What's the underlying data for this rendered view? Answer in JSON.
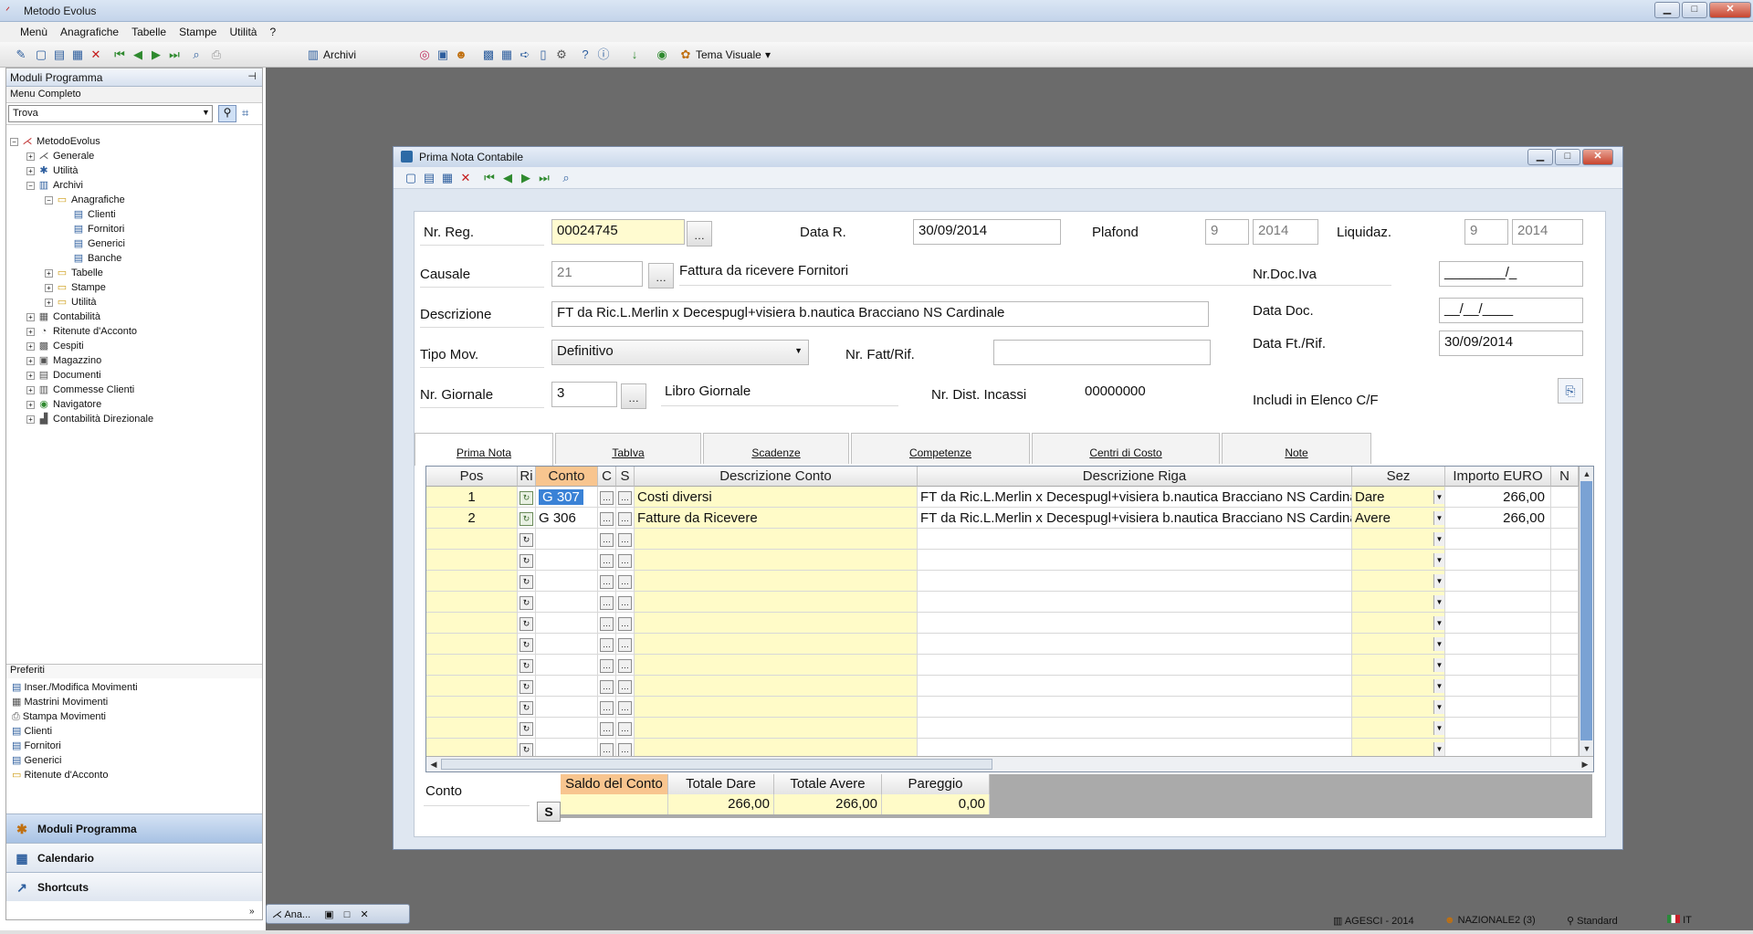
{
  "app": {
    "title": "Metodo Evolus"
  },
  "menu": [
    "Menù",
    "Anagrafiche",
    "Tabelle",
    "Stampe",
    "Utilità",
    "?"
  ],
  "toolbar": {
    "archivi_label": "Archivi",
    "theme_label": "Tema Visuale"
  },
  "left": {
    "header": "Moduli Programma",
    "subheader": "Menu Completo",
    "find_value": "Trova",
    "tree": [
      {
        "label": "MetodoEvolus",
        "level": 0,
        "icon": "root-icon"
      },
      {
        "label": "Generale",
        "level": 1,
        "icon": "module-icon"
      },
      {
        "label": "Utilità",
        "level": 1,
        "icon": "module-icon"
      },
      {
        "label": "Archivi",
        "level": 1,
        "icon": "module-icon"
      },
      {
        "label": "Anagrafiche",
        "level": 2,
        "icon": "folder-icon"
      },
      {
        "label": "Clienti",
        "level": 3,
        "icon": "form-icon"
      },
      {
        "label": "Fornitori",
        "level": 3,
        "icon": "form-icon"
      },
      {
        "label": "Generici",
        "level": 3,
        "icon": "form-icon"
      },
      {
        "label": "Banche",
        "level": 3,
        "icon": "form-icon"
      },
      {
        "label": "Tabelle",
        "level": 2,
        "icon": "folder-icon"
      },
      {
        "label": "Stampe",
        "level": 2,
        "icon": "folder-icon"
      },
      {
        "label": "Utilità",
        "level": 2,
        "icon": "folder-icon"
      },
      {
        "label": "Contabilità",
        "level": 1,
        "icon": "module-icon"
      },
      {
        "label": "Ritenute d'Acconto",
        "level": 1,
        "icon": "module-icon"
      },
      {
        "label": "Cespiti",
        "level": 1,
        "icon": "module-icon"
      },
      {
        "label": "Magazzino",
        "level": 1,
        "icon": "module-icon"
      },
      {
        "label": "Documenti",
        "level": 1,
        "icon": "module-icon"
      },
      {
        "label": "Commesse Clienti",
        "level": 1,
        "icon": "module-icon"
      },
      {
        "label": "Navigatore",
        "level": 1,
        "icon": "module-icon"
      },
      {
        "label": "Contabilità Direzionale",
        "level": 1,
        "icon": "module-icon"
      }
    ],
    "favorites_header": "Preferiti",
    "favorites": [
      "Inser./Modifica Movimenti",
      "Mastrini Movimenti",
      "Stampa Movimenti",
      "Clienti",
      "Fornitori",
      "Generici",
      "Ritenute d'Acconto"
    ],
    "nav": [
      "Moduli Programma",
      "Calendario",
      "Shortcuts"
    ]
  },
  "taskbar": {
    "mini_label": "Ana..."
  },
  "status": {
    "db": "AGESCI - 2014",
    "user": "NAZIONALE2 (3)",
    "profile": "Standard",
    "lang": "IT"
  },
  "dialog": {
    "title": "Prima Nota Contabile",
    "fields": {
      "nr_reg_label": "Nr. Reg.",
      "nr_reg": "00024745",
      "data_r_label": "Data R.",
      "data_r": "30/09/2014",
      "plafond_label": "Plafond",
      "plafond_month": "9",
      "plafond_year": "2014",
      "liquidaz_label": "Liquidaz.",
      "liquidaz_month": "9",
      "liquidaz_year": "2014",
      "causale_label": "Causale",
      "causale_code": "21",
      "causale_desc": "Fattura da ricevere Fornitori",
      "nr_doc_iva_label": "Nr.Doc.Iva",
      "nr_doc_iva": "________/_",
      "descrizione_label": "Descrizione",
      "descrizione": "FT da Ric.L.Merlin x Decespugl+visiera b.nautica Bracciano NS Cardinale",
      "data_doc_label": "Data Doc.",
      "data_doc": "__/__/____",
      "tipo_mov_label": "Tipo Mov.",
      "tipo_mov": "Definitivo",
      "nr_fatt_label": "Nr. Fatt/Rif.",
      "nr_fatt": "",
      "data_ft_label": "Data Ft./Rif.",
      "data_ft": "30/09/2014",
      "nr_giornale_label": "Nr. Giornale",
      "nr_giornale": "3",
      "libro_giornale_label": "Libro Giornale",
      "nr_dist_label": "Nr. Dist. Incassi",
      "nr_dist": "00000000",
      "includi_label": "Includi in Elenco C/F"
    },
    "tabs": [
      "Prima Nota",
      "TabIva",
      "Scadenze",
      "Competenze",
      "Centri di Costo",
      "Note"
    ],
    "grid": {
      "headers": [
        "Pos",
        "Ri",
        "Conto",
        "C",
        "S",
        "Descrizione Conto",
        "Descrizione Riga",
        "Sez",
        "Importo EURO",
        "N"
      ],
      "rows": [
        {
          "pos": "1",
          "conto": "G  307",
          "desc_conto": "Costi diversi",
          "desc_riga": "FT da Ric.L.Merlin x Decespugl+visiera b.nautica Bracciano NS Cardinale",
          "sez": "Dare",
          "importo": "266,00"
        },
        {
          "pos": "2",
          "conto": "G  306",
          "desc_conto": "Fatture da Ricevere",
          "desc_riga": "FT da Ric.L.Merlin x Decespugl+visiera b.nautica Bracciano NS Cardinale",
          "sez": "Avere",
          "importo": "266,00"
        }
      ],
      "empty_rows": 11
    },
    "totals": {
      "conto_label": "Conto",
      "s_button": "S",
      "headers": [
        "Saldo del Conto",
        "Totale Dare",
        "Totale Avere",
        "Pareggio"
      ],
      "values": [
        "",
        "266,00",
        "266,00",
        "0,00"
      ]
    }
  }
}
